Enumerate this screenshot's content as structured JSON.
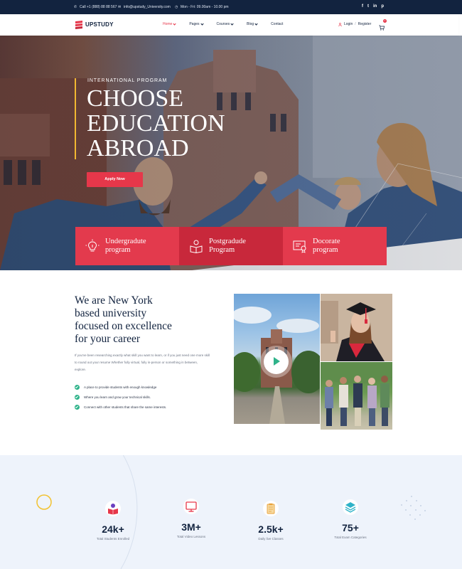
{
  "topbar": {
    "phone": "Call +1 (888) 88 88 567",
    "email": "info@upstudy_University.com",
    "hours": "Mon - Fri: 09.00am - 10.00 pm",
    "socials": [
      "f",
      "t",
      "in",
      "p"
    ]
  },
  "header": {
    "brand": "UPSTUDY",
    "nav": [
      {
        "label": "Home"
      },
      {
        "label": "Pages"
      },
      {
        "label": "Courses"
      },
      {
        "label": "Blog"
      },
      {
        "label": "Contact"
      }
    ],
    "login": "Login",
    "register": "Register",
    "cart_count": "0"
  },
  "hero": {
    "kicker": "INTERNATIONAL PROGRAM",
    "title_line1": "CHOOSE",
    "title_line2": "EDUCATION",
    "title_line3": "ABROAD",
    "cta": "Apply Now"
  },
  "programs": [
    {
      "line1": "Undergradute",
      "line2": "program"
    },
    {
      "line1": "Postgradude",
      "line2": "Program"
    },
    {
      "line1": "Docorate",
      "line2": "program"
    }
  ],
  "about": {
    "title_line1": "We are New York",
    "title_line2": "based university",
    "title_line3": "focused on excellence",
    "title_line4": "for your career",
    "text": "If you've been researching exactly what skill you want to learn, or if you just need one more skill to round out your resume Whether fully virtual, fully in-person or something in between, explore.",
    "checks": [
      "A place to provide students with enough knowledge",
      "Where you learn and grow your technical skills.",
      "Connect with other students that share the same interests."
    ]
  },
  "stats": [
    {
      "number": "24k+",
      "label": "Total Students Enrolled"
    },
    {
      "number": "3M+",
      "label": "Total Video Lessons"
    },
    {
      "number": "2.5k+",
      "label": "Daily live Classes"
    },
    {
      "number": "75+",
      "label": "Total Exam Categories"
    }
  ],
  "colors": {
    "primary": "#e6374a",
    "navy": "#12233f",
    "accent_yellow": "#f2b731",
    "green": "#2fb38a"
  }
}
